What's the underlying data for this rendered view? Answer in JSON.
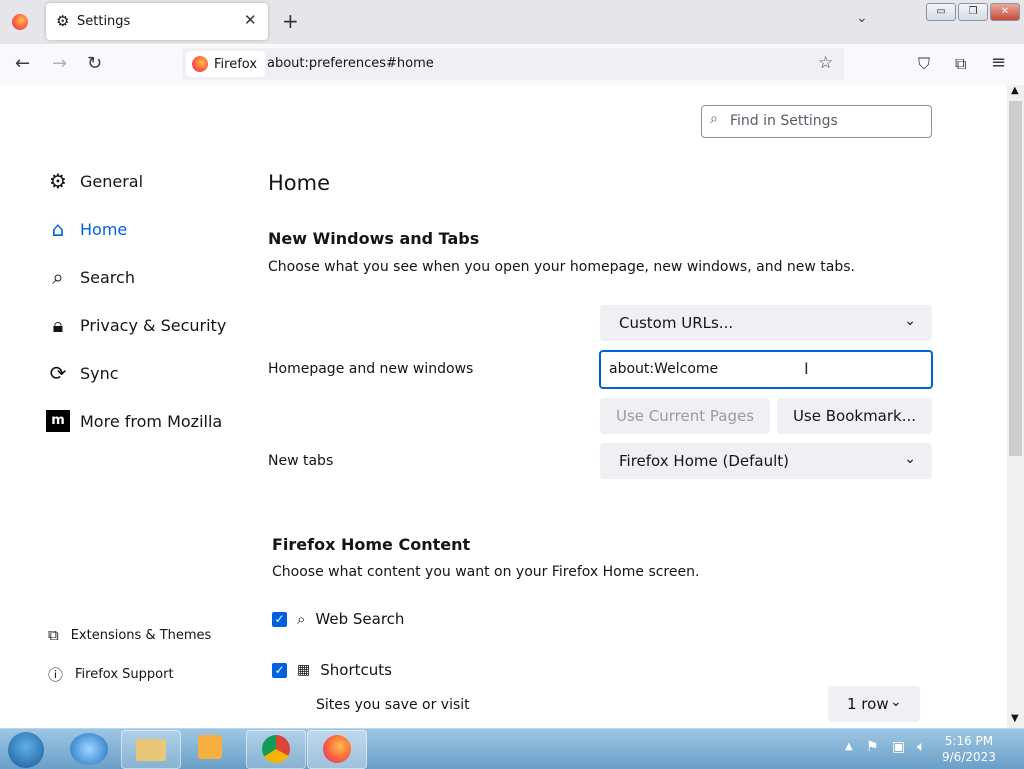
{
  "window": {
    "minimize": "▭",
    "restore": "❐",
    "close": "✕"
  },
  "tab": {
    "title": "Settings",
    "close": "✕",
    "new_tab": "+",
    "list_tabs": "⌄"
  },
  "nav": {
    "identity_label": "Firefox",
    "url": "about:preferences#home"
  },
  "find": {
    "placeholder": "Find in Settings"
  },
  "sidebar": {
    "items": [
      {
        "label": "General",
        "icon": "gear-icon"
      },
      {
        "label": "Home",
        "icon": "home-icon",
        "selected": true
      },
      {
        "label": "Search",
        "icon": "search-icon"
      },
      {
        "label": "Privacy & Security",
        "icon": "lock-icon"
      },
      {
        "label": "Sync",
        "icon": "sync-icon"
      },
      {
        "label": "More from Mozilla",
        "icon": "mozilla-icon"
      }
    ],
    "footer": [
      {
        "label": "Extensions & Themes",
        "icon": "puzzle-icon"
      },
      {
        "label": "Firefox Support",
        "icon": "help-icon"
      }
    ]
  },
  "main": {
    "title": "Home",
    "new_windows": {
      "heading": "New Windows and Tabs",
      "description": "Choose what you see when you open your homepage, new windows, and new tabs.",
      "homepage_dropdown": "Custom URLs...",
      "homepage_label": "Homepage and new windows",
      "homepage_value": "about:Welcome",
      "use_current": "Use Current Pages",
      "use_bookmark": "Use Bookmark...",
      "newtabs_label": "New tabs",
      "newtabs_value": "Firefox Home (Default)"
    },
    "home_content": {
      "heading": "Firefox Home Content",
      "description": "Choose what content you want on your Firefox Home screen.",
      "web_search": "Web Search",
      "shortcuts": "Shortcuts",
      "sites_label": "Sites you save or visit",
      "rows_value": "1 row"
    }
  },
  "taskbar": {
    "time": "5:16 PM",
    "date": "9/6/2023"
  },
  "colors": {
    "accent": "#0061e0",
    "tabstrip": "#e6e6ea"
  }
}
